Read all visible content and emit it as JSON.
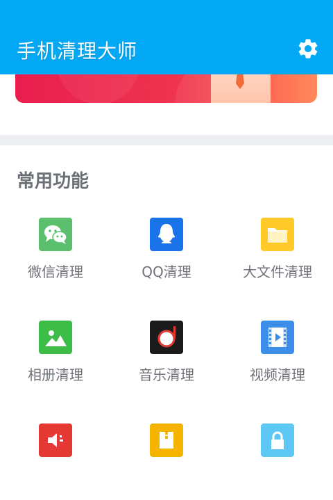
{
  "app": {
    "title": "手机清理大师"
  },
  "section": {
    "title": "常用功能"
  },
  "features": [
    {
      "label": "微信清理",
      "icon": "wechat-icon",
      "color": "#5cbf6e"
    },
    {
      "label": "QQ清理",
      "icon": "qq-icon",
      "color": "#1a73e8"
    },
    {
      "label": "大文件清理",
      "icon": "folder-icon",
      "color": "#ffc928"
    },
    {
      "label": "相册清理",
      "icon": "photo-icon",
      "color": "#3dbd48"
    },
    {
      "label": "音乐清理",
      "icon": "music-icon",
      "color": "#1b1b1b"
    },
    {
      "label": "视频清理",
      "icon": "video-icon",
      "color": "#3b8fe8"
    },
    {
      "label": "",
      "icon": "speaker-icon",
      "color": "#e53935"
    },
    {
      "label": "",
      "icon": "archive-icon",
      "color": "#f4b400"
    },
    {
      "label": "",
      "icon": "lock-icon",
      "color": "#5ec8f5"
    }
  ],
  "colors": {
    "appbar": "#03a9f4",
    "banner_start": "#e91e4f",
    "banner_end": "#ff8a5a"
  }
}
